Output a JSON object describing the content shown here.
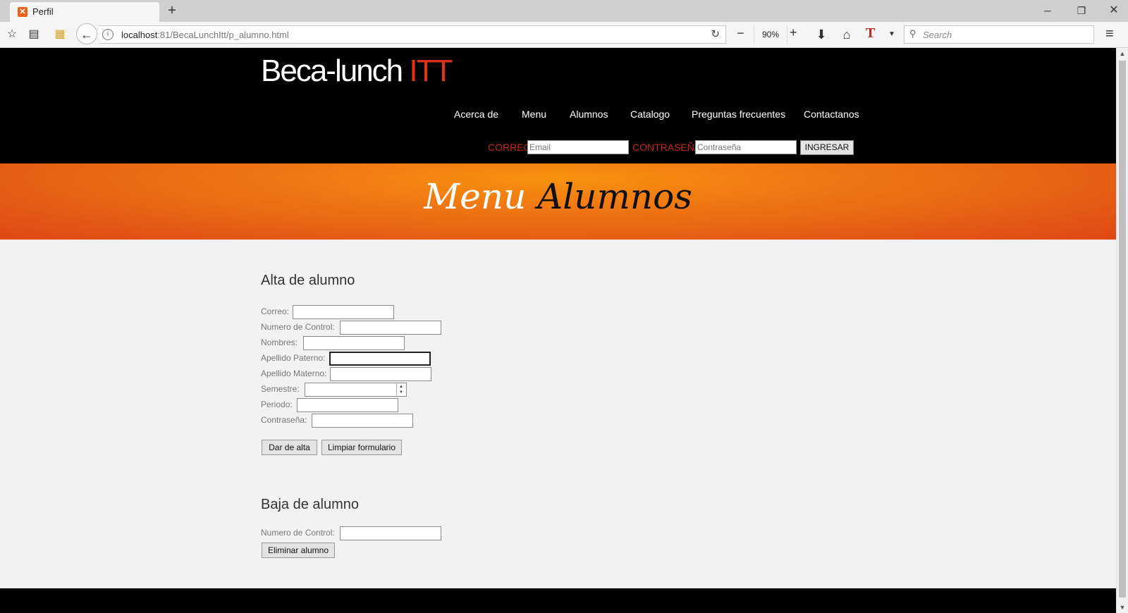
{
  "browser": {
    "tab_title": "Perfil",
    "url_host": "localhost",
    "url_rest": ":81/BecaLunchItt/p_alumno.html",
    "zoom": "90%",
    "search_placeholder": "Search"
  },
  "site": {
    "logo_main": "Beca-lunch",
    "logo_accent": "ITT",
    "nav": [
      "Acerca de",
      "Menu",
      "Alumnos",
      "Catalogo",
      "Preguntas frecuentes",
      "Contactanos"
    ],
    "login": {
      "email_label": "CORREO",
      "email_placeholder": "Email",
      "password_label": "CONTRASEÑA",
      "password_placeholder": "Contraseña",
      "submit": "INGRESAR"
    },
    "banner": {
      "word1": "Menu",
      "word2": "Alumnos"
    }
  },
  "alta": {
    "title": "Alta de alumno",
    "fields": {
      "correo": "Correo:",
      "numero_control": "Numero de Control:",
      "nombres": "Nombres:",
      "apellido_paterno": "Apellido Paterno:",
      "apellido_materno": "Apellido Materno:",
      "semestre": "Semestre:",
      "periodo": "Periodo:",
      "contrasena": "Contraseña:"
    },
    "submit": "Dar de alta",
    "reset": "Limpiar formulario"
  },
  "baja": {
    "title": "Baja de alumno",
    "numero_control": "Numero de Control:",
    "submit": "Eliminar alumno"
  }
}
